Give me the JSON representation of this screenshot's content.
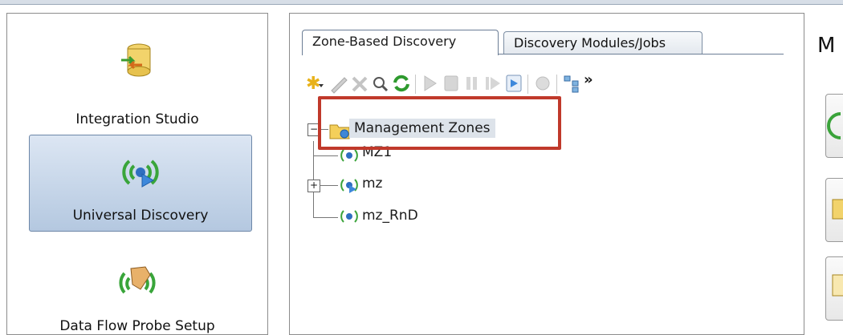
{
  "left_nav": {
    "items": [
      {
        "label": "Integration Studio"
      },
      {
        "label": "Universal Discovery"
      },
      {
        "label": "Data Flow Probe Setup"
      }
    ]
  },
  "middle": {
    "tabs": [
      {
        "label": "Zone-Based Discovery",
        "active": true
      },
      {
        "label": "Discovery Modules/Jobs",
        "active": false
      }
    ],
    "toolbar": {
      "more_label": "»"
    },
    "tree": {
      "root": "Management Zones",
      "children": [
        {
          "label": "MZ1"
        },
        {
          "label": "mz"
        },
        {
          "label": "mz_RnD"
        }
      ]
    }
  },
  "right": {
    "title_fragment": "M"
  },
  "colors": {
    "highlight": "#c0392b",
    "selected_nav": "#c6d5e8",
    "tree_selected": "#dde3ea"
  }
}
